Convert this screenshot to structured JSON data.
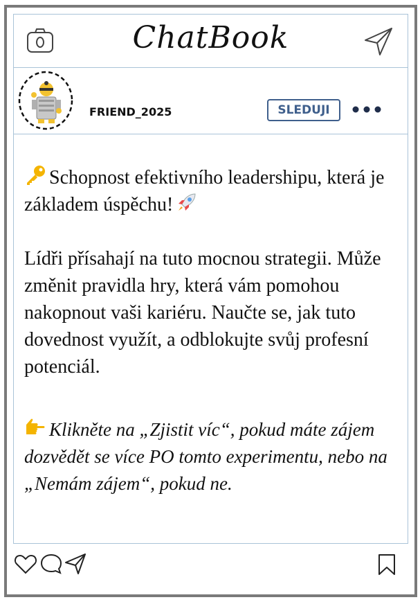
{
  "app": {
    "title": "ChatBook"
  },
  "profile": {
    "username": "FRIEND_2025",
    "follow_label": "SLEDUJI"
  },
  "post": {
    "line1": "Schopnost efektivního leadershipu, která je základem úspěchu!",
    "line2": "Lídři přísahají na tuto mocnou strategii. Může změnit pravidla hry, která vám pomohou nakopnout vaši kariéru. Naučte se, jak tuto dovednost využít, a odblokujte svůj profesní potenciál.",
    "cta": "Klikněte na „Zjistit víc“, pokud máte zájem dozvědět se více PO tomto experimentu, nebo na „Nemám zájem“, pokud ne."
  },
  "icons": {
    "camera": "camera-icon",
    "send": "paper-plane-icon",
    "more": "more-dots-icon",
    "key": "key-emoji-icon",
    "rocket": "rocket-emoji-icon",
    "pointing": "pointing-hand-emoji-icon",
    "like": "heart-icon",
    "comment": "comment-icon",
    "share": "share-icon",
    "bookmark": "bookmark-icon"
  },
  "colors": {
    "frame": "#7a7a7a",
    "divider": "#a9c3d8",
    "follow_accent": "#3f5f8c"
  }
}
